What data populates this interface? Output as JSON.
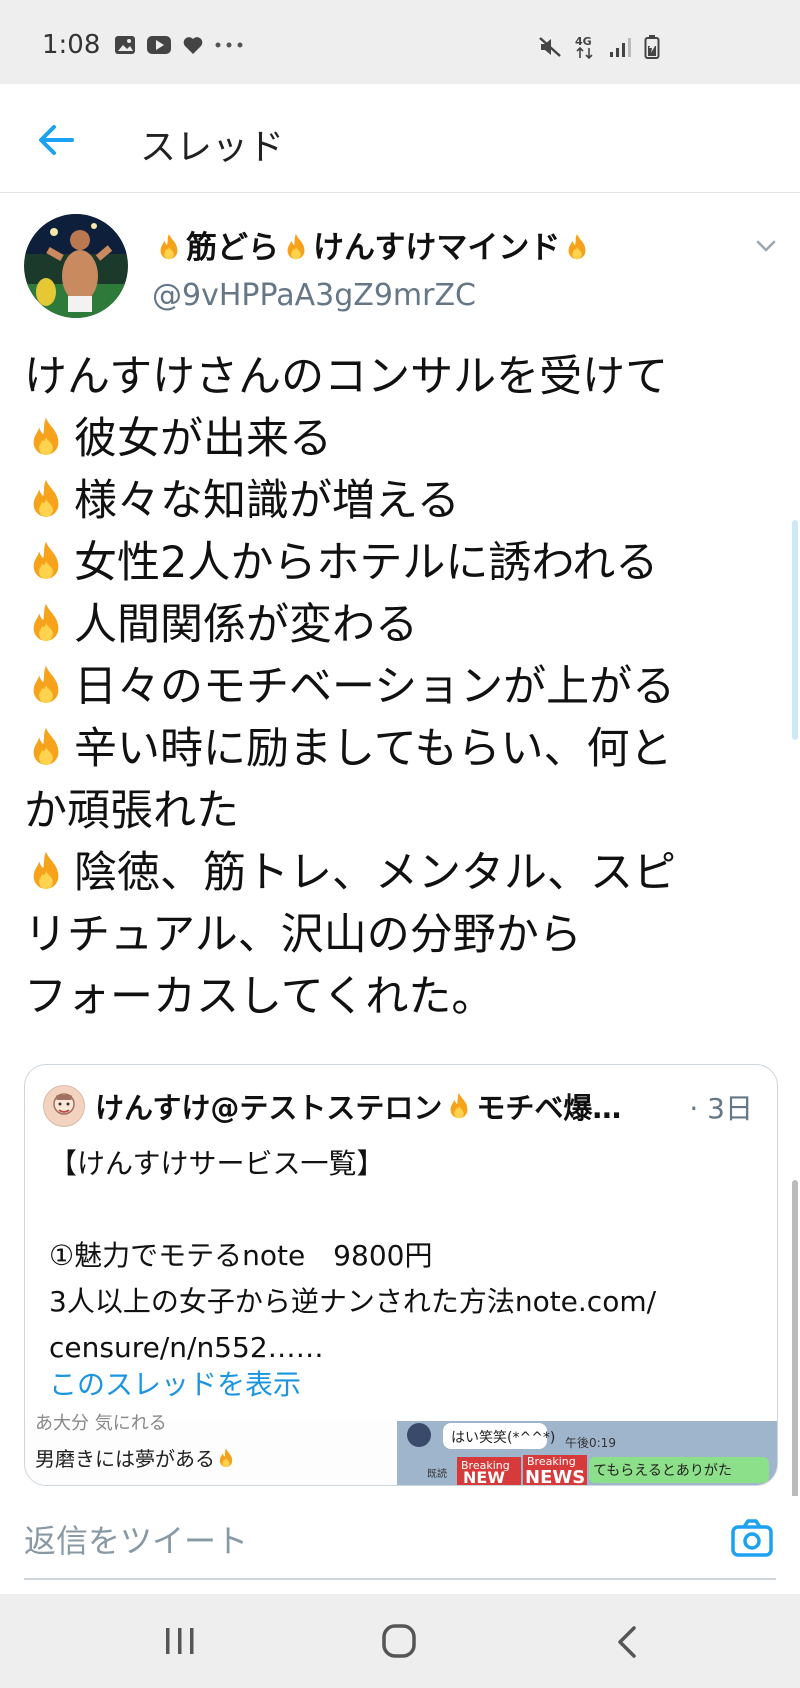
{
  "status_bar": {
    "time": "1:08",
    "left_icons": [
      "gallery-icon",
      "youtube-icon",
      "heart-icon",
      "more-dots-icon"
    ],
    "right_icons": [
      "mute-icon",
      "4g-icon",
      "signal-icon",
      "battery-icon"
    ]
  },
  "header": {
    "title": "スレッド"
  },
  "tweet": {
    "display_name": {
      "part1": "筋どら",
      "part2": "けんすけマインド"
    },
    "handle": "@9vHPPaA3gZ9mrZC",
    "lines": [
      {
        "fire": false,
        "text": "けんすけさんのコンサルを受けて"
      },
      {
        "fire": true,
        "text": "彼女が出来る"
      },
      {
        "fire": true,
        "text": "様々な知識が増える"
      },
      {
        "fire": true,
        "text": "女性2人からホテルに誘われる"
      },
      {
        "fire": true,
        "text": "人間関係が変わる"
      },
      {
        "fire": true,
        "text": "日々のモチベーションが上がる"
      },
      {
        "fire": true,
        "text": "辛い時に励ましてもらい、何と"
      },
      {
        "fire": false,
        "text": "か頑張れた"
      },
      {
        "fire": true,
        "text": "陰徳、筋トレ、メンタル、スピ"
      },
      {
        "fire": false,
        "text": "リチュアル、沢山の分野から"
      },
      {
        "fire": false,
        "text": "フォーカスしてくれた。"
      }
    ]
  },
  "quote": {
    "name_part1": "けんすけ@テストステロン",
    "name_part2": "モチベ爆…",
    "time": "· 3日",
    "text_lines": [
      "【けんすけサービス一覧】",
      "",
      "①魅力でモテるnote　9800円",
      "3人以上の女子から逆ナンされた方法note.com/",
      "censure/n/n552……"
    ],
    "show_thread_link": "このスレッドを表示",
    "media_left_faded": "あ大分 気にれる",
    "media_left_caption": "男磨きには夢がある",
    "media_right": {
      "bubble": "はい笑笑(*^^*)",
      "time": "午後0:19",
      "badge1": "Breaking",
      "badge2": "Breaking",
      "news1": "NEW",
      "news2": "NEWS",
      "snippet": "てもらえるとありがた",
      "read": "既読"
    }
  },
  "reply": {
    "placeholder": "返信をツイート"
  }
}
